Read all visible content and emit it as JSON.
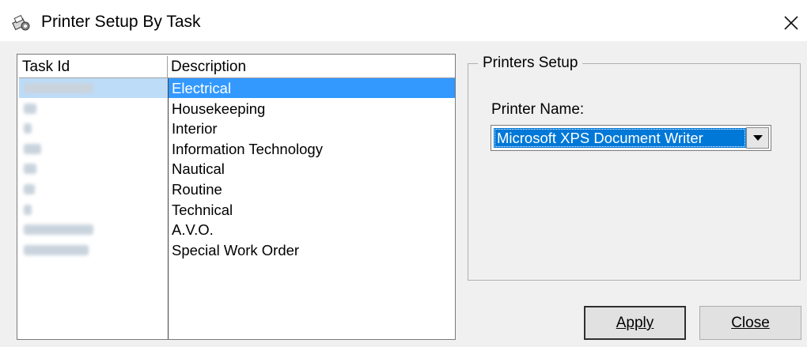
{
  "window": {
    "title": "Printer Setup By Task",
    "icon": "printer-gear-icon"
  },
  "task_grid": {
    "columns": [
      "Task Id",
      "Description"
    ],
    "rows": [
      {
        "task_id": "",
        "description": "Electrical",
        "selected": true
      },
      {
        "task_id": "",
        "description": "Housekeeping"
      },
      {
        "task_id": "",
        "description": "Interior"
      },
      {
        "task_id": "",
        "description": "Information Technology"
      },
      {
        "task_id": "",
        "description": "Nautical"
      },
      {
        "task_id": "",
        "description": "Routine"
      },
      {
        "task_id": "",
        "description": "Technical"
      },
      {
        "task_id": "",
        "description": "A.V.O."
      },
      {
        "task_id": "",
        "description": "Special Work Order"
      }
    ]
  },
  "printers_setup": {
    "group_label": "Printers Setup",
    "printer_name_label": "Printer Name:",
    "printer_name_value": "Microsoft XPS Document Writer"
  },
  "buttons": {
    "apply": "Apply",
    "close": "Close"
  },
  "colors": {
    "selection": "#3399ff",
    "combo_highlight": "#0078d7",
    "window_bg": "#f0f0f0"
  }
}
